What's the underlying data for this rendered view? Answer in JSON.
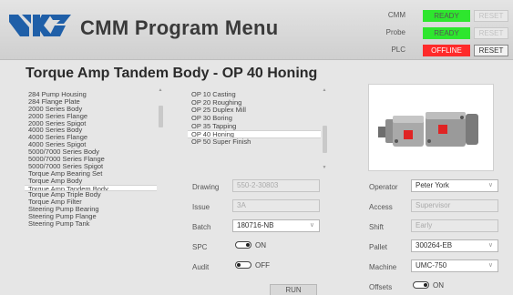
{
  "header": {
    "title": "CMM Program Menu",
    "logo_icon": "uk-flag-logo-icon",
    "status": [
      {
        "label": "CMM",
        "state": "READY",
        "color": "#2ee62e",
        "reset_label": "RESET",
        "reset_enabled": false
      },
      {
        "label": "Probe",
        "state": "READY",
        "color": "#2ee62e",
        "reset_label": "RESET",
        "reset_enabled": false
      },
      {
        "label": "PLC",
        "state": "OFFLINE",
        "color": "#ff2b2b",
        "reset_label": "RESET",
        "reset_enabled": true
      }
    ]
  },
  "page_title": "Torque Amp Tandem Body - OP 40 Honing",
  "parts": {
    "items": [
      "284 Pump Housing",
      "284 Flange Plate",
      "2000 Series Body",
      "2000 Series Flange",
      "2000 Series Spigot",
      "4000 Series Body",
      "4000 Series Flange",
      "4000 Series Spigot",
      "5000/7000 Series Body",
      "5000/7000 Series Flange",
      "5000/7000 Series Spigot",
      "Torque Amp Bearing Set",
      "Torque Amp Body",
      "Torque Amp Tandem Body",
      "Torque Amp Triple Body",
      "Torque Amp Filter",
      "Steering Pump Bearing",
      "Steering Pump Flange",
      "Steering Pump Tank"
    ],
    "selected_index": 13
  },
  "operations": {
    "items": [
      "OP 10 Casting",
      "OP 20 Roughing",
      "OP 25 Duplex Mill",
      "OP 30 Boring",
      "OP 35 Tapping",
      "OP 40 Honing",
      "OP 50 Super Finish"
    ],
    "selected_index": 5
  },
  "form": {
    "drawing_label": "Drawing",
    "drawing_value": "550-2-30803",
    "issue_label": "Issue",
    "issue_value": "3A",
    "batch_label": "Batch",
    "batch_value": "180716-NB",
    "spc_label": "SPC",
    "spc_state": "ON",
    "audit_label": "Audit",
    "audit_state": "OFF",
    "run_label": "RUN"
  },
  "right_form": {
    "operator_label": "Operator",
    "operator_value": "Peter York",
    "access_label": "Access",
    "access_value": "Supervisor",
    "shift_label": "Shift",
    "shift_value": "Early",
    "pallet_label": "Pallet",
    "pallet_value": "300264-EB",
    "machine_label": "Machine",
    "machine_value": "UMC-750",
    "offsets_label": "Offsets",
    "offsets_state": "ON"
  },
  "colors": {
    "accent": "#1f5fa8",
    "ready": "#2ee62e",
    "offline": "#ff2b2b"
  }
}
